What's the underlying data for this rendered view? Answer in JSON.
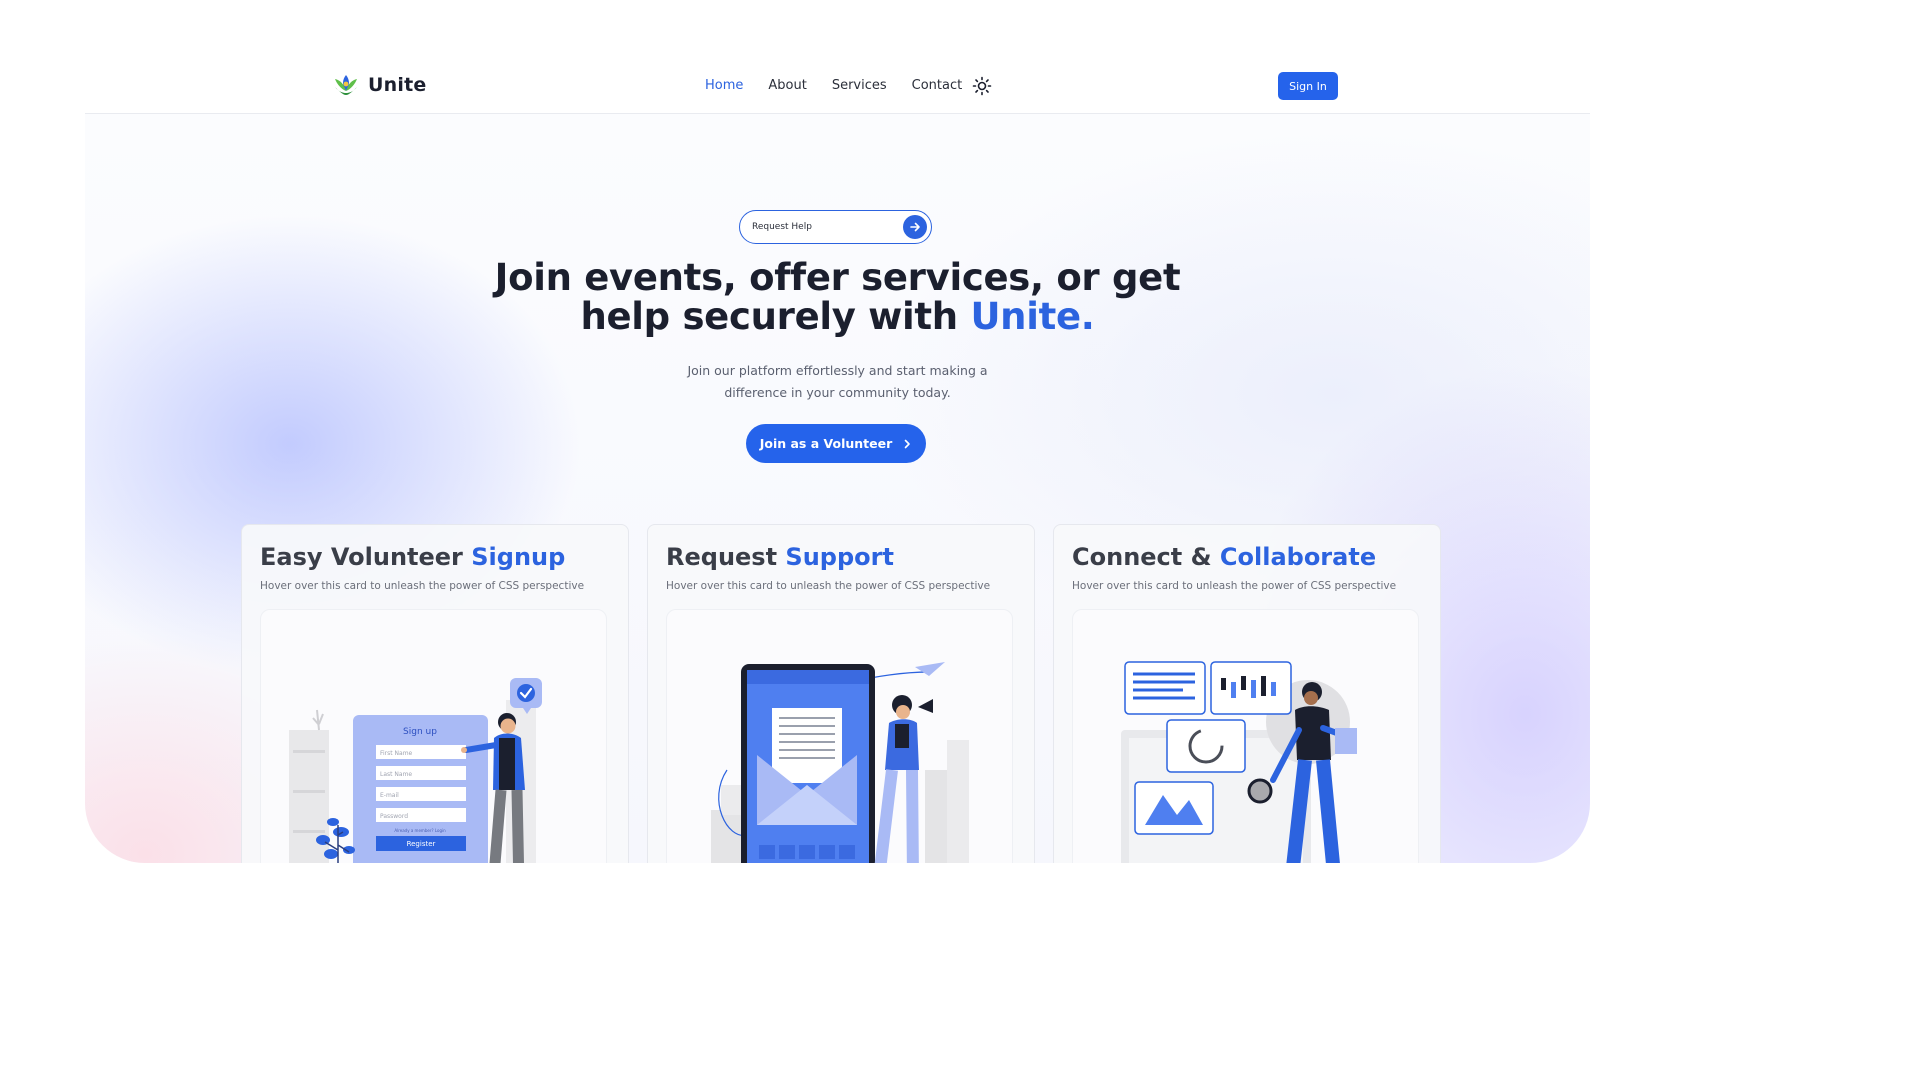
{
  "brand": {
    "name": "Unite"
  },
  "nav": {
    "links": [
      {
        "label": "Home",
        "active": true
      },
      {
        "label": "About",
        "active": false
      },
      {
        "label": "Services",
        "active": false
      },
      {
        "label": "Contact",
        "active": false
      }
    ],
    "theme_toggle_icon": "sun-icon",
    "signin_label": "Sign In"
  },
  "hero": {
    "pill_label": "Request Help",
    "headline_part1": "Join events, offer services, or get",
    "headline_part2": "help securely with ",
    "headline_accent": "Unite.",
    "subtitle": "Join our platform effortlessly and start making a difference in your community today.",
    "cta_label": "Join as a Volunteer"
  },
  "cards": [
    {
      "title": "Easy Volunteer ",
      "title_accent": "Signup",
      "desc": "Hover over this card to unleash the power of CSS perspective",
      "illustration": {
        "form_title": "Sign up",
        "fields": [
          "First Name",
          "Last Name",
          "E-mail",
          "Password"
        ],
        "note": "Already a member? Login",
        "button": "Register"
      }
    },
    {
      "title": "Request ",
      "title_accent": "Support",
      "desc": "Hover over this card to unleash the power of CSS perspective"
    },
    {
      "title": "Connect & ",
      "title_accent": "Collaborate",
      "desc": "Hover over this card to unleash the power of CSS perspective"
    }
  ],
  "colors": {
    "accent": "#2c63df",
    "button": "#2563eb",
    "text": "#1b1f2e"
  }
}
